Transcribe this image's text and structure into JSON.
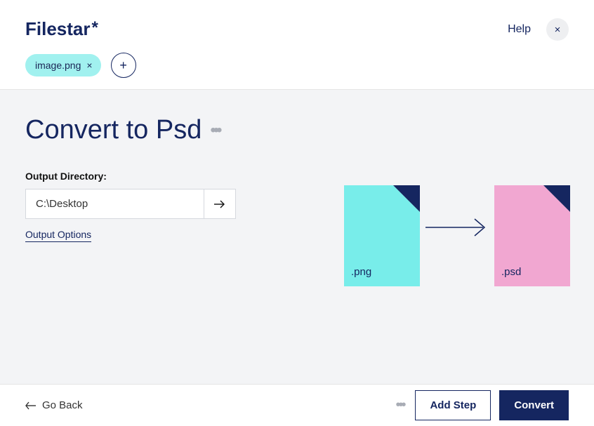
{
  "app": {
    "name": "Filestar",
    "help_label": "Help"
  },
  "files": {
    "chip_label": "image.png"
  },
  "page": {
    "title": "Convert to Psd"
  },
  "output": {
    "label": "Output Directory:",
    "directory": "C:\\Desktop",
    "options_label": "Output Options"
  },
  "diagram": {
    "source_ext": ".png",
    "target_ext": ".psd"
  },
  "footer": {
    "back_label": "Go Back",
    "add_step_label": "Add Step",
    "convert_label": "Convert"
  }
}
